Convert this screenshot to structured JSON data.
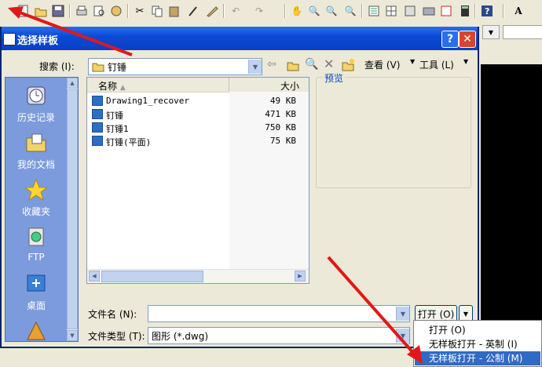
{
  "dialog": {
    "title": "选择样板",
    "help": "?",
    "close": "✕"
  },
  "search": {
    "label": "搜索 (I):",
    "value": "钉锤",
    "view_label": "查看 (V)",
    "tools_label": "工具 (L)"
  },
  "places": [
    {
      "label": "历史记录",
      "icon": "history-icon"
    },
    {
      "label": "我的文档",
      "icon": "my-documents-icon"
    },
    {
      "label": "收藏夹",
      "icon": "favorites-icon"
    },
    {
      "label": "FTP",
      "icon": "ftp-icon"
    },
    {
      "label": "桌面",
      "icon": "desktop-icon"
    }
  ],
  "filelist": {
    "col_name": "名称",
    "col_size": "大小",
    "files": [
      {
        "name": "Drawing1_recover",
        "size": "49 KB"
      },
      {
        "name": "钉锤",
        "size": "471 KB"
      },
      {
        "name": "钉锤1",
        "size": "750 KB"
      },
      {
        "name": "钉锤(平面)",
        "size": "75 KB"
      }
    ]
  },
  "preview": {
    "label": "预览"
  },
  "filename": {
    "label": "文件名 (N):",
    "value": ""
  },
  "filetype": {
    "label": "文件类型 (T):",
    "value": "图形 (*.dwg)"
  },
  "open_button": {
    "label": "打开 (O)"
  },
  "open_menu": {
    "items": [
      {
        "label": "打开 (O)",
        "selected": false
      },
      {
        "label": "无样板打开 - 英制 (I)",
        "selected": false
      },
      {
        "label": "无样板打开 - 公制 (M)",
        "selected": true
      }
    ]
  },
  "colors": {
    "title_bar": "#0c4ad6",
    "places_bar": "#7b9bdc",
    "menu_highlight": "#316ac5",
    "annotation_arrow": "#e01818"
  }
}
